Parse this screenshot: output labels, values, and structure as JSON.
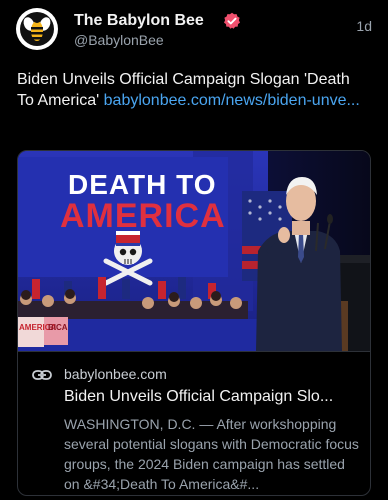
{
  "post": {
    "author": {
      "display_name": "The Babylon Bee",
      "handle": "@BabylonBee",
      "verified_icon": "verified-badge-icon",
      "avatar_icon": "bee-logo-icon"
    },
    "timestamp": "1d",
    "text": "Biden Unveils Official Campaign Slogan 'Death To America'",
    "link_text": "babylonbee.com/news/biden-unve..."
  },
  "card": {
    "image": {
      "banner_line1": "DEATH TO",
      "banner_line2": "AMERICA",
      "sign_text": "AMERICA",
      "sign_text2": "BICA"
    },
    "domain": "babylonbee.com",
    "title": "Biden Unveils Official Campaign Slo...",
    "description": "WASHINGTON, D.C. — After workshopping several potential slogans with Democratic focus groups, the 2024 Biden campaign has settled on &#34;Death To America&#..."
  },
  "colors": {
    "background": "#000000",
    "link": "#4aa5f0",
    "verified": "#f0506e",
    "secondary_text": "#9aa3ad"
  }
}
